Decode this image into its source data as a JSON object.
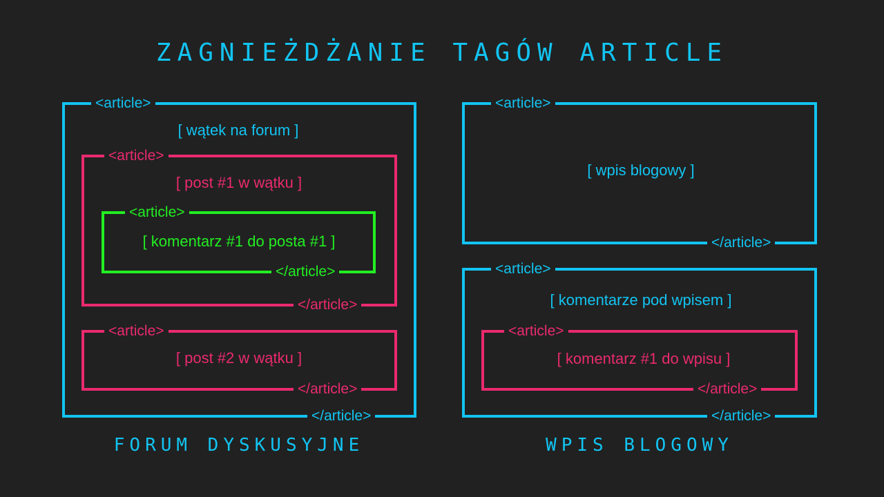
{
  "title": "ZAGNIEŻDŻANIE TAGÓW ARTICLE",
  "open_tag": "<article>",
  "close_tag": "</article>",
  "colors": {
    "background": "#212121",
    "cyan": "#12c4f2",
    "pink": "#ea2a6e",
    "green": "#22ee22"
  },
  "forum": {
    "caption": "FORUM DYSKUSYJNE",
    "thread": "[ wątek na forum ]",
    "post1": "[ post #1 w wątku ]",
    "comment1": "[ komentarz #1 do posta #1 ]",
    "post2": "[ post #2 w wątku ]"
  },
  "blog": {
    "caption": "WPIS BLOGOWY",
    "entry": "[ wpis blogowy ]",
    "comments": "[ komentarze pod wpisem ]",
    "comment1": "[ komentarz #1 do wpisu ]"
  }
}
